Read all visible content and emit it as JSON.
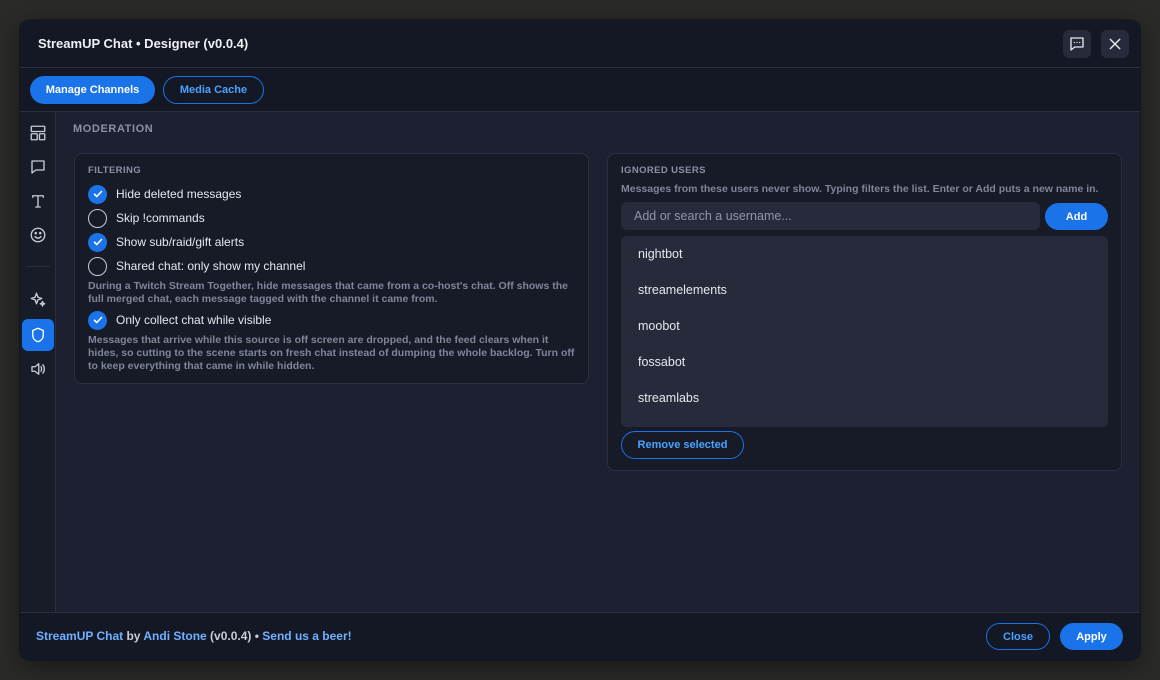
{
  "window": {
    "title": "StreamUP Chat • Designer (v0.0.4)"
  },
  "toolbar": {
    "manage_channels": "Manage Channels",
    "media_cache": "Media Cache"
  },
  "sidebar": {
    "items": [
      {
        "icon": "layout-icon",
        "active": false
      },
      {
        "icon": "chat-bubble-icon",
        "active": false
      },
      {
        "icon": "text-icon",
        "active": false
      },
      {
        "icon": "emoji-icon",
        "active": false
      },
      {
        "icon": "sparkle-icon",
        "active": false
      },
      {
        "icon": "shield-icon",
        "active": true
      },
      {
        "icon": "speaker-icon",
        "active": false
      }
    ]
  },
  "main": {
    "section_title": "MODERATION",
    "filtering": {
      "title": "FILTERING",
      "options": [
        {
          "label": "Hide deleted messages",
          "checked": true
        },
        {
          "label": "Skip !commands",
          "checked": false
        },
        {
          "label": "Show sub/raid/gift alerts",
          "checked": true
        },
        {
          "label": "Shared chat: only show my channel",
          "checked": false
        },
        {
          "label": "Only collect chat while visible",
          "checked": true
        }
      ],
      "shared_chat_help": "During a Twitch Stream Together, hide messages that came from a co-host's chat. Off shows the full merged chat, each message tagged with the channel it came from.",
      "visible_help": "Messages that arrive while this source is off screen are dropped, and the feed clears when it hides, so cutting to the scene starts on fresh chat instead of dumping the whole backlog. Turn off to keep everything that came in while hidden."
    },
    "ignored_users": {
      "title": "IGNORED USERS",
      "description": "Messages from these users never show. Typing filters the list. Enter or Add puts a new name in.",
      "search_placeholder": "Add or search a username...",
      "add_label": "Add",
      "users": [
        "nightbot",
        "streamelements",
        "moobot",
        "fossabot",
        "streamlabs"
      ],
      "remove_label": "Remove selected"
    }
  },
  "footer": {
    "product": "StreamUP Chat",
    "by": " by ",
    "author": "Andi Stone",
    "version": " (v0.0.4) • ",
    "beer_link": "Send us a beer!",
    "close_label": "Close",
    "apply_label": "Apply"
  },
  "colors": {
    "accent": "#1a73e8",
    "link": "#6fb1ff"
  }
}
